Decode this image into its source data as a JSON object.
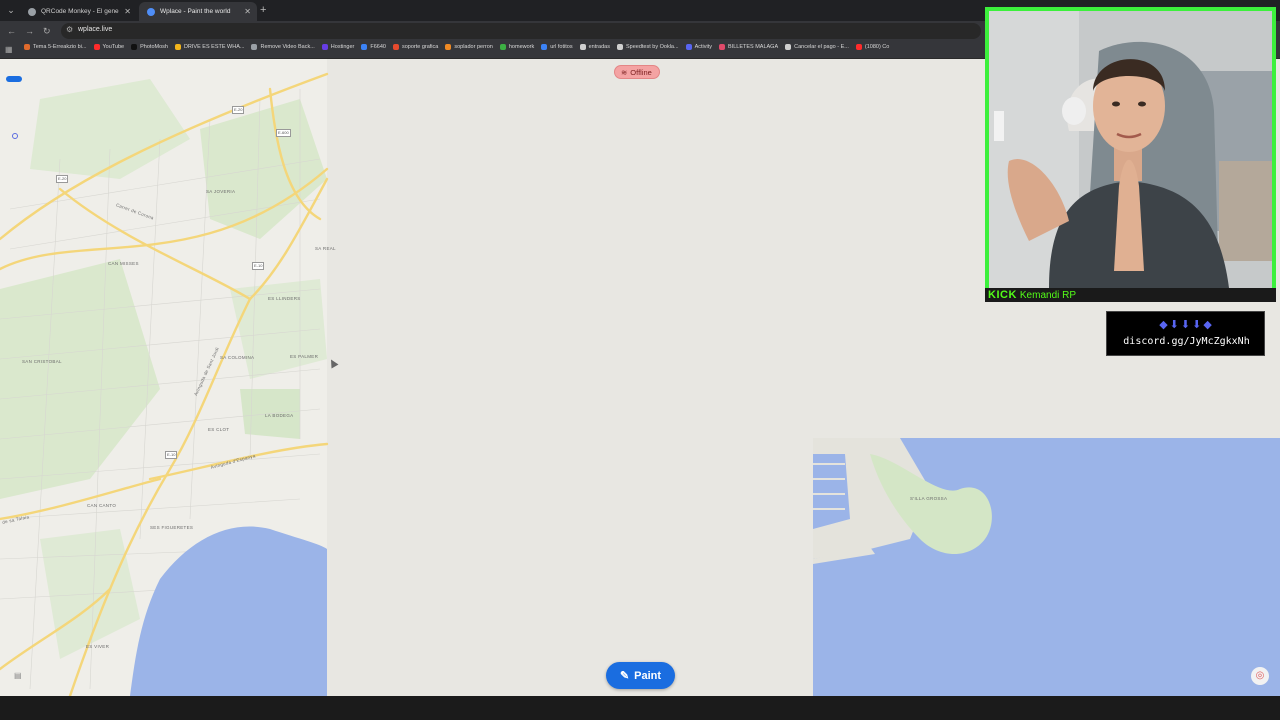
{
  "browser": {
    "tabs": [
      {
        "title": "QRCode Monkey - El generado",
        "fav_color": "#9aa0a6"
      },
      {
        "title": "Wplace - Paint the world",
        "fav_color": "#4f8ef7"
      }
    ],
    "url": "wplace.live"
  },
  "bookmarks": [
    {
      "label": "Tema 5-Erreakzio bi...",
      "color": "#e06a2c"
    },
    {
      "label": "YouTube",
      "color": "#ff2b2b"
    },
    {
      "label": "PhotoMosh",
      "color": "#111111"
    },
    {
      "label": "DRIVE ES ESTE WHA...",
      "color": "#f3b51b"
    },
    {
      "label": "Remove Video Back...",
      "color": "#9aa0a6"
    },
    {
      "label": "Hostinger",
      "color": "#673de6"
    },
    {
      "label": "F6640",
      "color": "#3b82f6"
    },
    {
      "label": "soporte grafica",
      "color": "#e64a2e"
    },
    {
      "label": "soplador perron",
      "color": "#f08a24"
    },
    {
      "label": "homework",
      "color": "#3cb043"
    },
    {
      "label": "url fotitos",
      "color": "#3b82f6"
    },
    {
      "label": "entradas",
      "color": "#cfcfcf"
    },
    {
      "label": "Speedtest by Ookla...",
      "color": "#cfcfcf"
    },
    {
      "label": "Activity",
      "color": "#5865f2"
    },
    {
      "label": "BILLETES MALAGA",
      "color": "#e04a6a"
    },
    {
      "label": "Cancelar el pago - E...",
      "color": "#cfcfcf"
    },
    {
      "label": "(1080) Co",
      "color": "#ff2b2b"
    }
  ],
  "map": {
    "status": "Offline",
    "paint_label": "Paint",
    "places": [
      "SA JOVERIA",
      "CAN MISSES",
      "ES LLINDERS",
      "SA COLOMINA",
      "ES PALMER",
      "SAN CRISTOBAL",
      "LA BODEGA",
      "ES CLOT",
      "CAN CANTO",
      "SES FIGUERETES",
      "ES VIVER",
      "SA REAL",
      "S'ILLA GROSSA"
    ],
    "streets": [
      "Carrer de Corona",
      "Avinguda de Sant Jordi",
      "Avinguda d'Espanya",
      "de sa Talaia"
    ],
    "roads": [
      "E-20",
      "E-600",
      "E-20",
      "E-10",
      "E-10"
    ]
  },
  "stream": {
    "platform": "KICK",
    "channel": "Kemandi RP",
    "discord_icons": "◆⬇⬇⬇◆",
    "discord_link": "discord.gg/JyMcZgkxNh"
  }
}
